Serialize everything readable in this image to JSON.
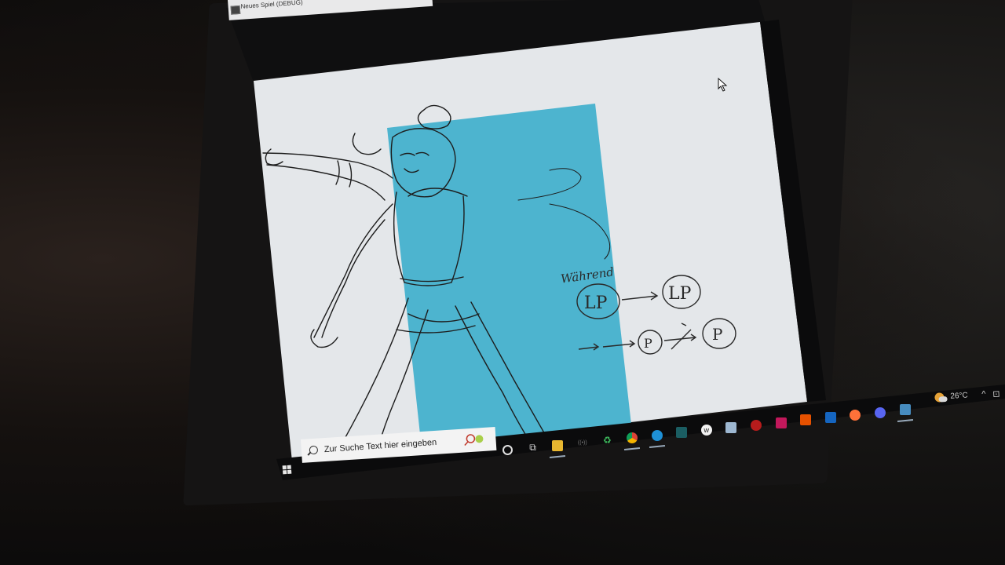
{
  "window": {
    "title": "Neues Spiel (DEBUG)"
  },
  "canvas": {
    "background_color": "#e4e7ea",
    "panel_color": "#45b1cd",
    "handwritten_note": "Während",
    "diagram_row1": [
      "LP",
      "LP"
    ],
    "diagram_row2": [
      "P",
      "P",
      "P"
    ]
  },
  "taskbar": {
    "search_placeholder": "Zur Suche Text hier eingeben",
    "pinned_icons": [
      "cortana-icon",
      "task-view-icon",
      "file-explorer-icon",
      "wifi-app-icon",
      "green-app-icon",
      "chrome-icon",
      "edge-icon",
      "terminal-app-icon",
      "w-app-icon",
      "photo-app-icon",
      "red-app-icon",
      "pink-app-icon",
      "orange-app-icon",
      "blue-app-icon",
      "firefox-icon",
      "discord-icon",
      "godot-icon"
    ],
    "tray": {
      "temperature": "26°C",
      "chevron": "^"
    }
  }
}
